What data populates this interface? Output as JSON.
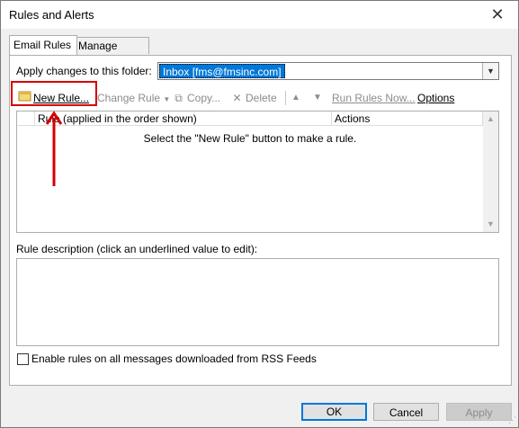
{
  "window": {
    "title": "Rules and Alerts",
    "close_glyph": "✕"
  },
  "tabs": [
    {
      "label": "Email Rules"
    },
    {
      "label": "Manage Alerts"
    }
  ],
  "folder": {
    "label": "Apply changes to this folder:",
    "value": "Inbox [fms@fmsinc.com]"
  },
  "toolbar": {
    "new_rule": "New Rule...",
    "change_rule": "Change Rule",
    "copy": "Copy...",
    "delete": "Delete",
    "run_rules_now": "Run Rules Now...",
    "options": "Options"
  },
  "rules_list": {
    "col_rule": "Rule (applied in the order shown)",
    "col_actions": "Actions",
    "empty_message": "Select the \"New Rule\" button to make a rule."
  },
  "description": {
    "label": "Rule description (click an underlined value to edit):"
  },
  "rss": {
    "label": "Enable rules on all messages downloaded from RSS Feeds"
  },
  "buttons": {
    "ok": "OK",
    "cancel": "Cancel",
    "apply": "Apply"
  },
  "colors": {
    "highlight": "#d40000",
    "selection": "#0078d7"
  }
}
